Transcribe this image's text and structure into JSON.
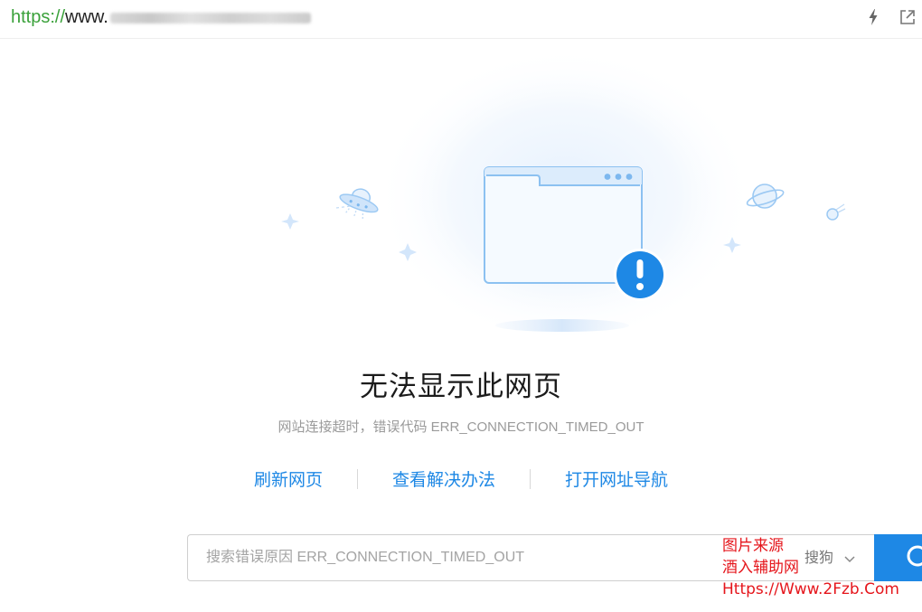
{
  "address_bar": {
    "scheme": "https://",
    "host_prefix": "www."
  },
  "error": {
    "title": "无法显示此网页",
    "subtitle": "网站连接超时，错误代码 ERR_CONNECTION_TIMED_OUT"
  },
  "actions": {
    "refresh": "刷新网页",
    "solutions": "查看解决办法",
    "navigation": "打开网址导航"
  },
  "search": {
    "placeholder": "搜索错误原因 ERR_CONNECTION_TIMED_OUT",
    "engine": "搜狗"
  },
  "watermark": {
    "line1": "图片来源",
    "line2": "酒入辅助网",
    "line3": "Https://Www.2Fzb.Com"
  },
  "colors": {
    "accent": "#1e88e5",
    "scheme_green": "#3aa13a",
    "watermark_red": "#e5161c"
  }
}
